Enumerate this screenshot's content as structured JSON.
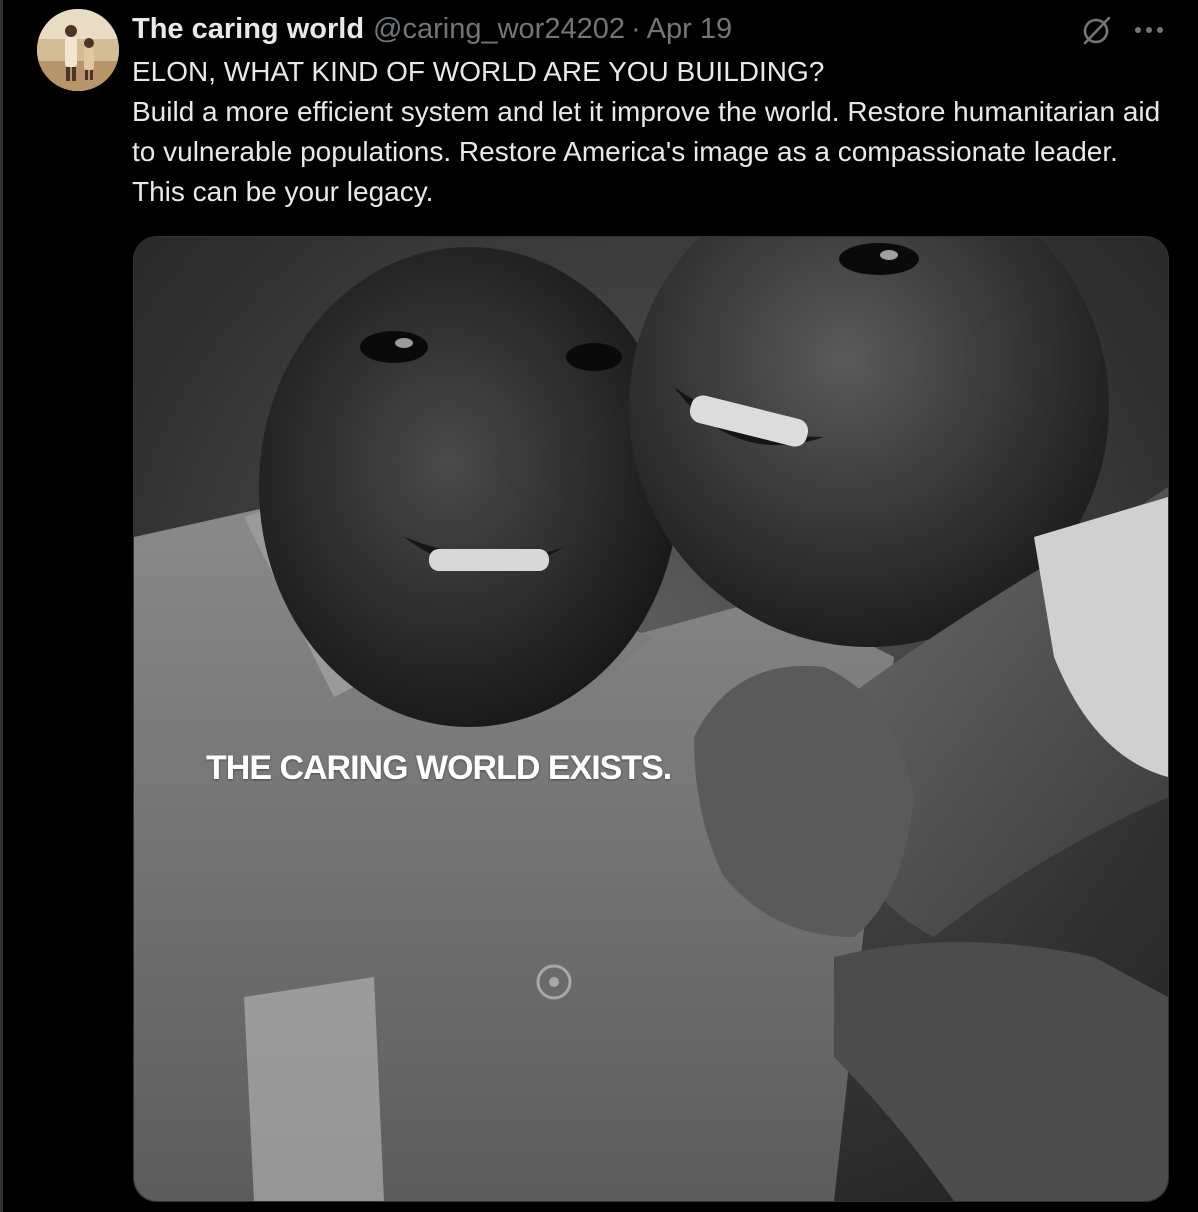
{
  "tweet": {
    "author": {
      "display_name": "The caring world",
      "handle": "@caring_wor24202",
      "avatar_icon": "avatar-photo"
    },
    "separator": "·",
    "date": "Apr 19",
    "text_lines": [
      "ELON, WHAT KIND OF WORLD ARE YOU BUILDING?",
      "Build a more efficient system and let it improve the world. Restore humanitarian aid to vulnerable populations. Restore America's image as a compassionate leader. This can be your legacy."
    ],
    "media": {
      "overlay_text": "THE CARING WORLD EXISTS."
    },
    "actions": {
      "grok_icon": "grok-icon",
      "more_icon": "more-dots-icon"
    }
  },
  "colors": {
    "background": "#000000",
    "primary_text": "#e7e9ea",
    "secondary_text": "#71767b",
    "border": "#2f3336"
  }
}
